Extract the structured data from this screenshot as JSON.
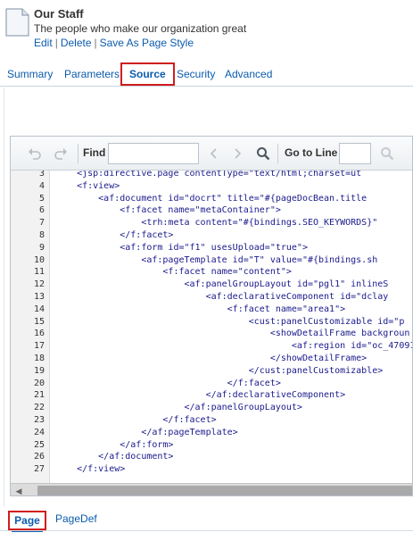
{
  "header": {
    "title": "Our Staff",
    "subtitle": "The people who make our organization great",
    "links": {
      "edit": "Edit",
      "delete": "Delete",
      "save_as": "Save As Page Style",
      "sep": "|"
    },
    "icon": "page-document-icon"
  },
  "tabs": [
    "Summary",
    "Parameters",
    "Source",
    "Security",
    "Advanced"
  ],
  "active_tab": "Source",
  "toolbar": {
    "undo_icon": "undo-icon",
    "redo_icon": "redo-icon",
    "find_label": "Find",
    "find_value": "",
    "prev_icon": "chevron-left-icon",
    "next_icon": "chevron-right-icon",
    "search_icon": "magnifier-icon",
    "goto_label": "Go to Line",
    "goto_value": ""
  },
  "code_lines": [
    {
      "n": "3",
      "text": "    <jsp:directive.page contentType=\"text/html;charset=ut"
    },
    {
      "n": "4",
      "text": "    <f:view>"
    },
    {
      "n": "5",
      "text": "        <af:document id=\"docrt\" title=\"#{pageDocBean.title"
    },
    {
      "n": "6",
      "text": "            <f:facet name=\"metaContainer\">"
    },
    {
      "n": "7",
      "text": "                <trh:meta content=\"#{bindings.SEO_KEYWORDS}\""
    },
    {
      "n": "8",
      "text": "            </f:facet>"
    },
    {
      "n": "9",
      "text": "            <af:form id=\"f1\" usesUpload=\"true\">"
    },
    {
      "n": "10",
      "text": "                <af:pageTemplate id=\"T\" value=\"#{bindings.sh"
    },
    {
      "n": "11",
      "text": "                    <f:facet name=\"content\">"
    },
    {
      "n": "12",
      "text": "                        <af:panelGroupLayout id=\"pgl1\" inlineS"
    },
    {
      "n": "13",
      "text": "                            <af:declarativeComponent id=\"dclay"
    },
    {
      "n": "14",
      "text": "                                <f:facet name=\"area1\">"
    },
    {
      "n": "15",
      "text": "                                    <cust:panelCustomizable id=\"p"
    },
    {
      "n": "16",
      "text": "                                        <showDetailFrame backgroun"
    },
    {
      "n": "17",
      "text": "                                            <af:region id=\"oc_47091"
    },
    {
      "n": "18",
      "text": "                                        </showDetailFrame>"
    },
    {
      "n": "19",
      "text": "                                    </cust:panelCustomizable>"
    },
    {
      "n": "20",
      "text": "                                </f:facet>"
    },
    {
      "n": "21",
      "text": "                            </af:declarativeComponent>"
    },
    {
      "n": "22",
      "text": "                        </af:panelGroupLayout>"
    },
    {
      "n": "23",
      "text": "                    </f:facet>"
    },
    {
      "n": "24",
      "text": "                </af:pageTemplate>"
    },
    {
      "n": "25",
      "text": "            </af:form>"
    },
    {
      "n": "26",
      "text": "        </af:document>"
    },
    {
      "n": "27",
      "text": "    </f:view>"
    }
  ],
  "scrollbar": {
    "left_arrow": "◀"
  },
  "bottom_tabs": [
    "Page",
    "PageDef"
  ],
  "active_bottom_tab": "Page",
  "colors": {
    "link": "#0b5cad",
    "highlight_border": "#d01e1e",
    "code_text": "#1a1a8c"
  }
}
